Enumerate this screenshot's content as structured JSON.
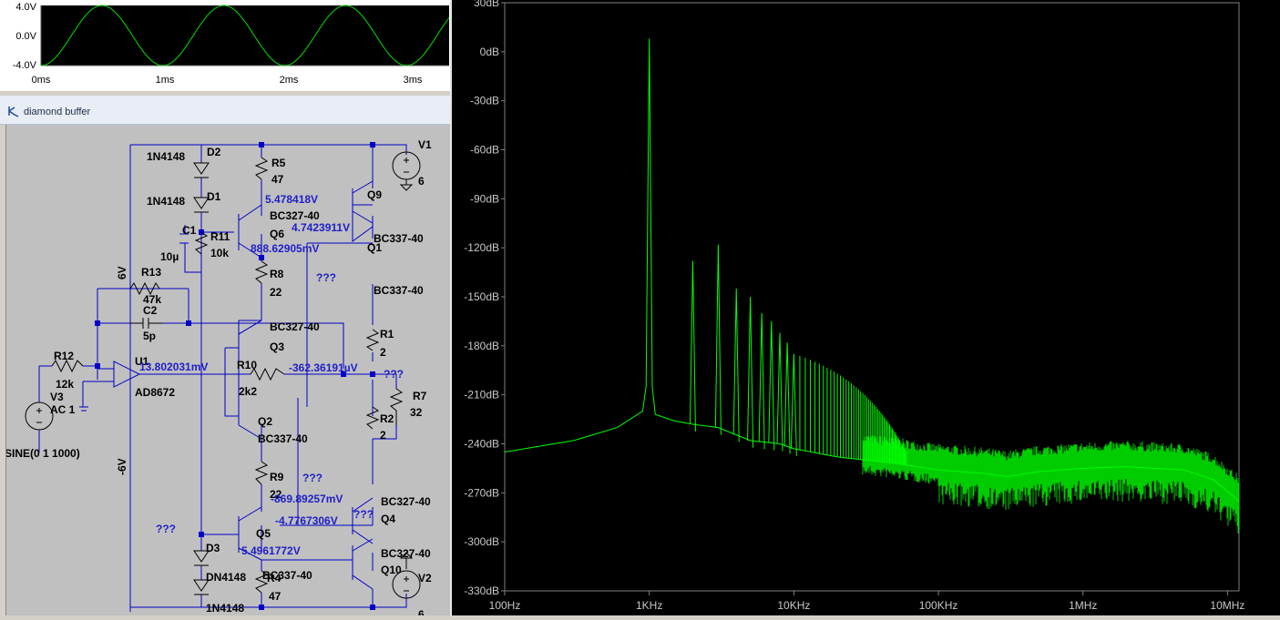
{
  "waveform_pane": {
    "y_ticks": [
      "4.0V",
      "0.0V",
      "-4.0V"
    ],
    "x_ticks": [
      "0ms",
      "1ms",
      "2ms",
      "3ms"
    ],
    "trace_color": "#00e000",
    "trace": {
      "amplitude_V": 4.0,
      "frequency_Hz": 1000,
      "x_range_ms": [
        0,
        3.35
      ],
      "y_range_V": [
        -4.0,
        4.0
      ]
    }
  },
  "schematic_window": {
    "title": "diamond buffer",
    "wire_color": "#0000c8",
    "text_color": "#000000",
    "annotation_color": "#2020c8",
    "components": {
      "d2_label": "D2",
      "d2_model": "1N4148",
      "d1_label": "D1",
      "d1_model": "1N4148",
      "r5_label": "R5",
      "r5_value": "47",
      "q9_label": "Q9",
      "v1_label": "V1",
      "v1_value": "6",
      "q6_model": "BC327-40",
      "q6_label": "Q6",
      "c1_label": "C1",
      "c1_value": "10µ",
      "r11_label": "R11",
      "r11_value": "10k",
      "q1_model": "BC337-40",
      "q1_label": "Q1",
      "rail_pos": "6V",
      "r13_label": "R13",
      "r13_value": "47k",
      "r8_label": "R8",
      "r8_value": "22",
      "q_upper_model": "BC337-40",
      "c2_label": "C2",
      "c2_value": "5p",
      "q3_model": "BC327-40",
      "q3_label": "Q3",
      "r1_label": "R1",
      "r1_value": "2",
      "r12_label": "R12",
      "r12_value": "12k",
      "u1_label": "U1",
      "u1_model": "AD8672",
      "r10_label": "R10",
      "r10_value": "2k2",
      "r7_label": "R7",
      "r7_value": "32",
      "v3_label": "V3",
      "v3_ac": "AC 1",
      "v3_sine": "SINE(0 1 1000)",
      "r2_label": "R2",
      "r2_value": "2",
      "q2_label": "Q2",
      "q2_model": "BC337-40",
      "rail_neg": "-6V",
      "r9_label": "R9",
      "r9_value": "22",
      "q4_model": "BC327-40",
      "q4_label": "Q4",
      "q5_label": "Q5",
      "d3_label": "D3",
      "q10_model": "BC327-40",
      "q10_label": "Q10",
      "d4_overlap": "DN4148",
      "q_lower_model": "BC337-40",
      "r4_label": "R4",
      "r4_value": "47",
      "v2_label": "V2",
      "v2_value": "6",
      "d4_model": "1N4148"
    },
    "node_voltages": {
      "n1": "5.478418V",
      "n2": "4.7423911V",
      "n3": "888.62905mV",
      "n4": "13.802031mV",
      "n5": "-362.36191µV",
      "n6": "-869.89257mV",
      "n7": "-4.7767306V",
      "n8": "5.4961772V"
    },
    "unknown_marks": [
      "???",
      "???",
      "???",
      "???",
      "???"
    ]
  },
  "fft_pane": {
    "trace_color": "#00ff00",
    "y_ticks": [
      "30dB",
      "0dB",
      "-30dB",
      "-60dB",
      "-90dB",
      "-120dB",
      "-150dB",
      "-180dB",
      "-210dB",
      "-240dB",
      "-270dB",
      "-300dB",
      "-330dB"
    ],
    "x_ticks": [
      "100Hz",
      "1KHz",
      "10KHz",
      "100KHz",
      "1MHz",
      "10MHz"
    ]
  },
  "chart_data": {
    "type": "line",
    "title": "",
    "xlabel": "",
    "ylabel": "",
    "x_scale": "log",
    "xlim": [
      100,
      12000000
    ],
    "ylim": [
      -330,
      30
    ],
    "grid": false,
    "series": [
      {
        "x": [
          100,
          300,
          600,
          900,
          950,
          1000,
          1050,
          1100,
          1500,
          2000,
          3000,
          5000,
          8000,
          10000,
          20000,
          50000,
          100000,
          200000,
          300000,
          500000,
          1000000,
          2000000,
          5000000,
          8000000,
          12000000
        ],
        "values": [
          -245,
          -238,
          -230,
          -220,
          -205,
          8,
          -205,
          -222,
          -226,
          -228,
          -230,
          -238,
          -240,
          -243,
          -248,
          -252,
          -256,
          -258,
          -260,
          -257,
          -255,
          -254,
          -256,
          -262,
          -275
        ]
      }
    ],
    "harmonics": [
      {
        "x": 2000,
        "y": -128
      },
      {
        "x": 3000,
        "y": -118
      },
      {
        "x": 4000,
        "y": -145
      },
      {
        "x": 5000,
        "y": -150
      },
      {
        "x": 6000,
        "y": -160
      },
      {
        "x": 7000,
        "y": -165
      },
      {
        "x": 8000,
        "y": -172
      },
      {
        "x": 9000,
        "y": -178
      },
      {
        "x": 10000,
        "y": -185
      }
    ]
  }
}
